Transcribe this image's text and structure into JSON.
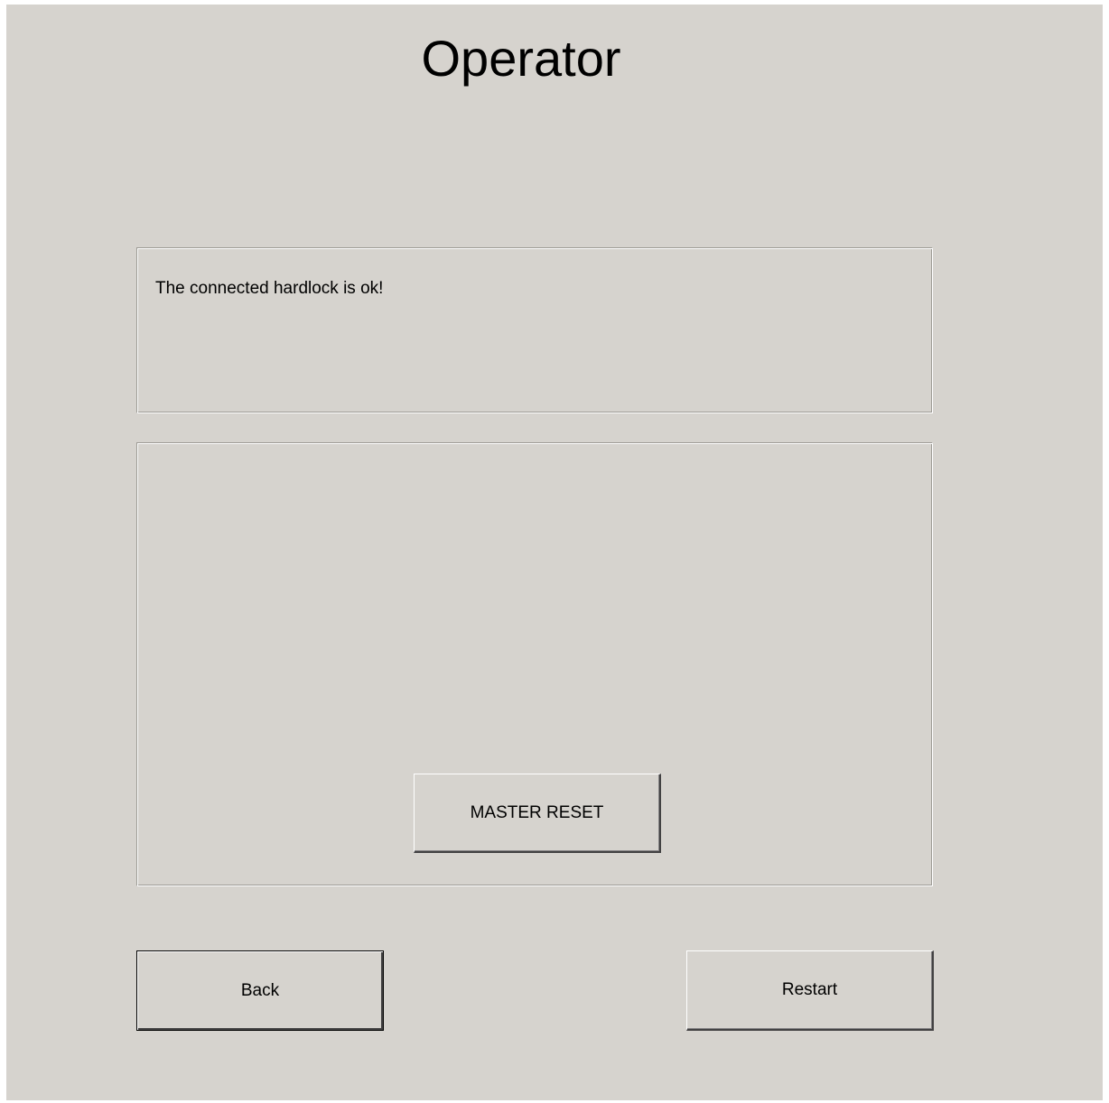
{
  "window": {
    "title": "Operator"
  },
  "status": {
    "message": "The connected hardlock is ok!"
  },
  "reset_panel": {
    "master_reset_label": "MASTER RESET"
  },
  "footer": {
    "back_label": "Back",
    "restart_label": "Restart"
  },
  "colors": {
    "background": "#d6d3ce",
    "text": "#000000"
  }
}
